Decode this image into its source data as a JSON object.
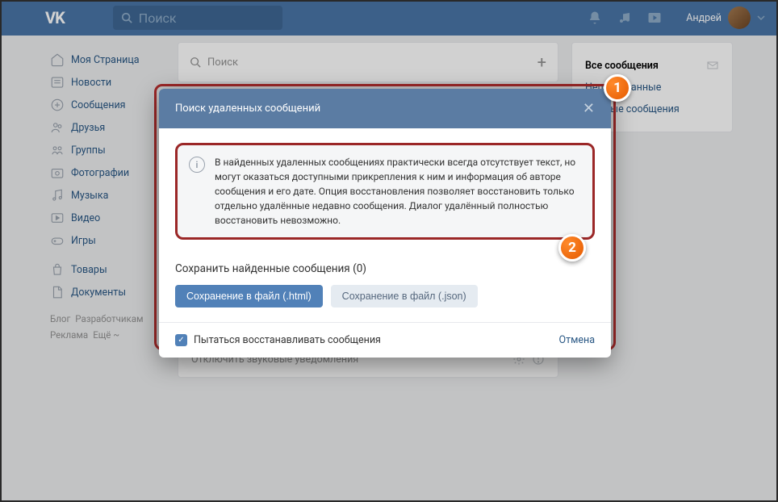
{
  "header": {
    "logo": "VK",
    "search_placeholder": "Поиск",
    "username": "Андрей"
  },
  "sidebar": {
    "items": [
      {
        "label": "Моя Страница",
        "icon": "home"
      },
      {
        "label": "Новости",
        "icon": "news"
      },
      {
        "label": "Сообщения",
        "icon": "msg"
      },
      {
        "label": "Друзья",
        "icon": "friends"
      },
      {
        "label": "Группы",
        "icon": "groups"
      },
      {
        "label": "Фотографии",
        "icon": "photos"
      },
      {
        "label": "Музыка",
        "icon": "music"
      },
      {
        "label": "Видео",
        "icon": "video"
      },
      {
        "label": "Игры",
        "icon": "games"
      }
    ],
    "items2": [
      {
        "label": "Товары",
        "icon": "goods"
      },
      {
        "label": "Документы",
        "icon": "docs"
      }
    ],
    "footer": [
      "Блог",
      "Разработчикам",
      "Реклама",
      "Ещё ~"
    ]
  },
  "messages": {
    "search_placeholder": "Поиск",
    "tabs": {
      "all": "Все сообщения",
      "unread": "Непрочитанные",
      "important": "Важные сообщения"
    },
    "sound_toggle": "Отключить звуковые уведомления"
  },
  "modal": {
    "title": "Поиск удаленных сообщений",
    "info_text": "В найденных удаленных сообщениях практически всегда отсутствует текст, но могут оказаться доступными прикрепления к ним и информация об авторе сообщения и его дате. Опция восстановления позволяет восстановить только отдельно удалённые недавно сообщения. Диалог удалённый полностью восстановить невозможно.",
    "save_title": "Сохранить найденные сообщения (0)",
    "btn_html": "Сохранение в файл (.html)",
    "btn_json": "Сохранение в файл (.json)",
    "checkbox_label": "Пытаться восстанавливать сообщения",
    "cancel": "Отмена"
  },
  "callouts": {
    "one": "1",
    "two": "2"
  }
}
